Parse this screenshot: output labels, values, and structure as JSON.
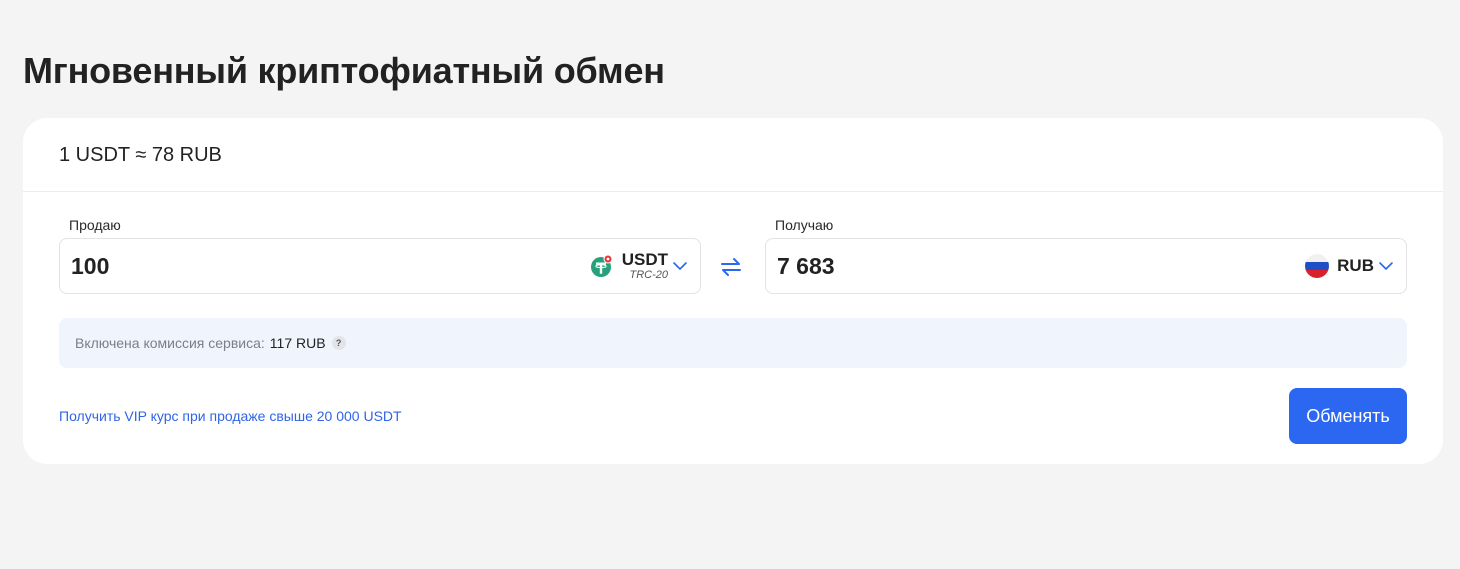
{
  "page_title": "Мгновенный криптофиатный обмен",
  "rate": "1 USDT ≈ 78 RUB",
  "sell": {
    "label": "Продаю",
    "amount": "100",
    "currency": "USDT",
    "network": "TRC-20",
    "icon": "tether-icon"
  },
  "receive": {
    "label": "Получаю",
    "amount": "7 683",
    "currency": "RUB",
    "icon": "russia-flag-icon"
  },
  "commission": {
    "label": "Включена комиссия сервиса:",
    "value": "117 RUB",
    "help": "?"
  },
  "vip_link": "Получить VIP курс при продаже свыше 20 000 USDT",
  "exchange_button": "Обменять",
  "colors": {
    "accent": "#2c67f2",
    "link": "#2f65e8",
    "tether_green": "#26a17b",
    "badge_red": "#e5383b",
    "commission_bg": "#eff4fd"
  }
}
